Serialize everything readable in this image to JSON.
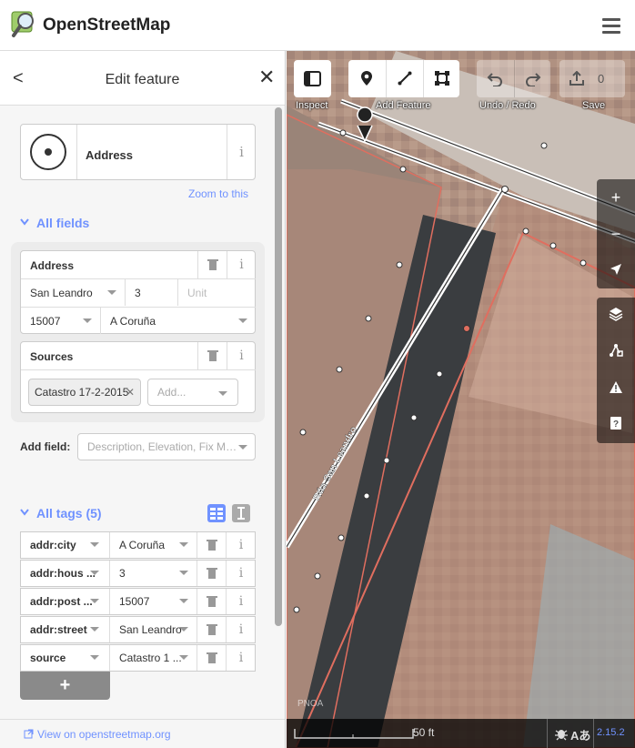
{
  "app": {
    "title": "OpenStreetMap"
  },
  "sidebar": {
    "header_title": "Edit feature",
    "back_label": "<",
    "close_label": "✕",
    "preset_name": "Address",
    "zoom_to_this": "Zoom to this",
    "all_fields_label": "All fields",
    "address_field": {
      "label": "Address",
      "street": "San Leandro",
      "housenumber": "3",
      "unit_placeholder": "Unit",
      "postcode": "15007",
      "city": "A Coruña"
    },
    "sources_field": {
      "label": "Sources",
      "chip": "Catastro 17-2-2015",
      "add_placeholder": "Add..."
    },
    "add_field": {
      "label": "Add field:",
      "placeholder": "Description, Elevation, Fix Me..."
    },
    "all_tags_label": "All tags (5)",
    "tags": [
      {
        "key": "addr:city",
        "value": "A Coruña"
      },
      {
        "key": "addr:hous ...",
        "value": "3"
      },
      {
        "key": "addr:post ...",
        "value": "15007"
      },
      {
        "key": "addr:street",
        "value": "San Leandro"
      },
      {
        "key": "source",
        "value": "Catastro 1 ..."
      }
    ],
    "add_tag_label": "+",
    "footer_link": "View on openstreetmap.org"
  },
  "toolbar": {
    "inspect_label": "Inspect",
    "add_feature_label": "Add Feature",
    "undo_redo_label": "Undo / Redo",
    "save_label": "Save",
    "save_count": "0"
  },
  "map": {
    "street_label": "Rúa San Leandro",
    "imagery_label": "PNOA",
    "scale_label": "50 ft",
    "version": "2.15.2"
  },
  "colors": {
    "accent": "#7092ff",
    "area_outline": "#e06e5f"
  },
  "icons": [
    "menu-icon",
    "pin-icon",
    "line-icon",
    "area-icon",
    "undo-icon",
    "redo-icon",
    "upload-icon",
    "zoom-in-icon",
    "zoom-out-icon",
    "geolocate-icon",
    "layers-icon",
    "map-data-icon",
    "issues-icon",
    "help-icon",
    "trash-icon",
    "info-icon",
    "text-view-icon",
    "list-view-icon"
  ]
}
